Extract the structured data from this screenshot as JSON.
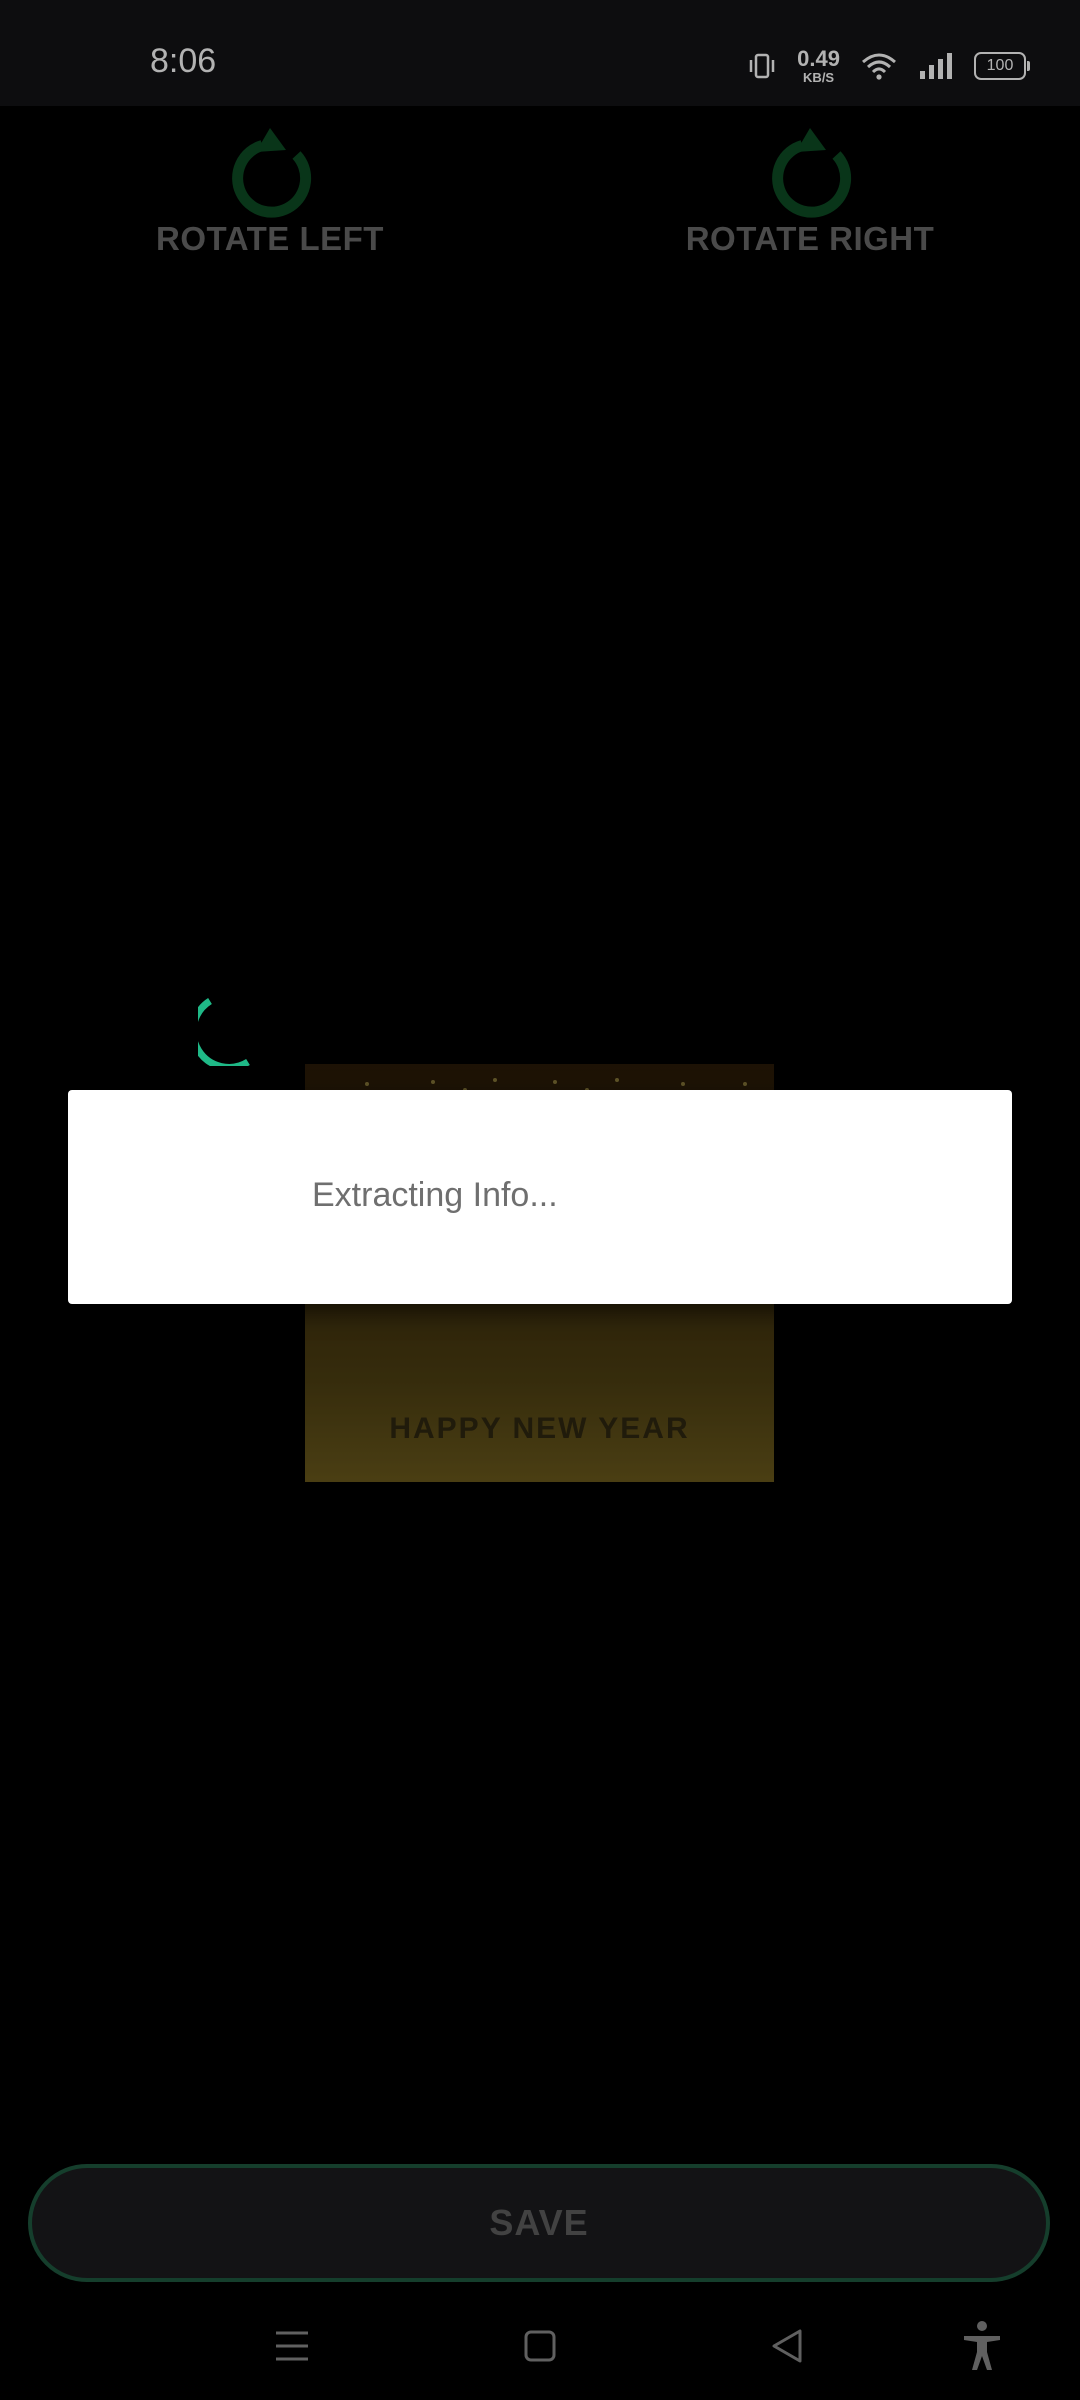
{
  "status_bar": {
    "time": "8:06",
    "net_speed": "0.49",
    "net_unit": "KB/S",
    "battery": "100"
  },
  "toolbar": {
    "rotate_left_label": "ROTATE LEFT",
    "rotate_right_label": "ROTATE RIGHT"
  },
  "preview": {
    "caption": "HAPPY NEW YEAR"
  },
  "dialog": {
    "message": "Extracting Info..."
  },
  "save": {
    "label": "SAVE"
  },
  "colors": {
    "accent": "#1fb987",
    "rotate_icon": "#0d4d25",
    "save_border": "#1f5a40"
  },
  "icons": [
    "vibrate-icon",
    "wifi-icon",
    "signal-icon",
    "battery-icon",
    "rotate-left-icon",
    "rotate-right-icon",
    "menu-icon",
    "home-icon",
    "back-icon",
    "accessibility-icon"
  ]
}
